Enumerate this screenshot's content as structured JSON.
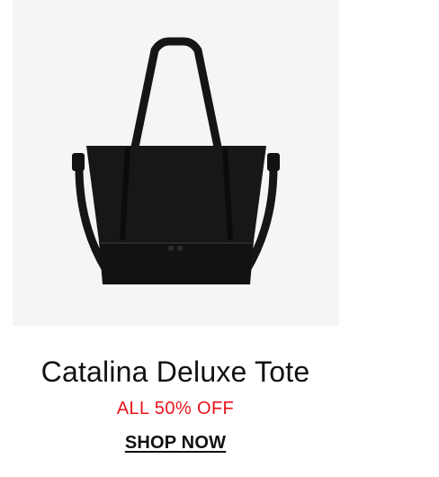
{
  "product": {
    "name": "Catalina Deluxe Tote",
    "promo": "ALL 50% OFF",
    "cta_label": "SHOP NOW",
    "image_alt": "black tote bag"
  },
  "colors": {
    "image_background": "#f5f5f5",
    "promo": "#e8141c",
    "text": "#111111",
    "bag": "#151515"
  }
}
